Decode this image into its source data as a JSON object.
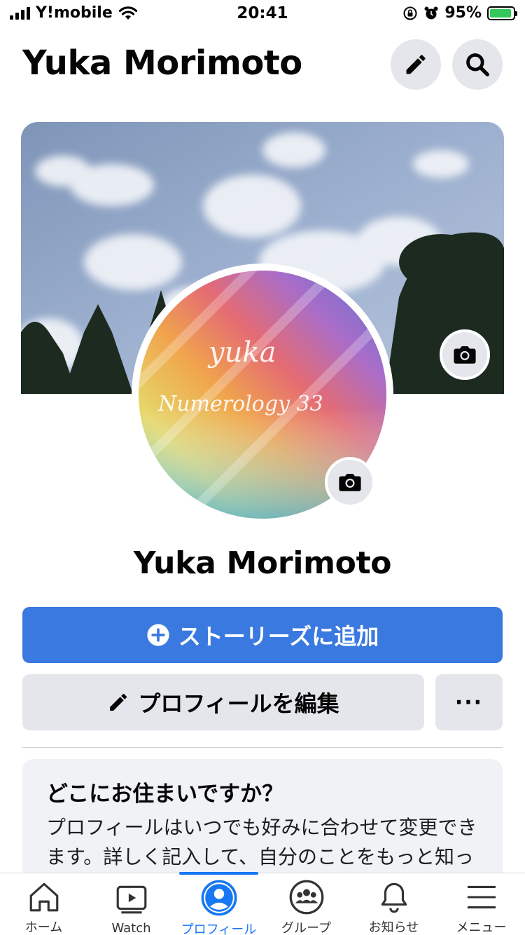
{
  "status_bar": {
    "carrier": "Y!mobile",
    "time": "20:41",
    "battery_percent": "95%",
    "battery_level": 0.95
  },
  "header": {
    "title": "Yuka Morimoto",
    "edit_icon": "pencil-icon",
    "search_icon": "search-icon"
  },
  "profile": {
    "name": "Yuka Morimoto",
    "avatar_text_line1": "yuka",
    "avatar_text_line2": "Numerology 33"
  },
  "actions": {
    "add_story_label": "ストーリーズに追加",
    "edit_profile_label": "プロフィールを編集",
    "more_label": "···"
  },
  "info_card": {
    "title": "どこにお住まいですか？",
    "body": "プロフィールはいつでも好みに合わせて変更できます。詳しく記入して、自分のことをもっと知ってもらおう。"
  },
  "tabs": [
    {
      "label": "ホーム",
      "icon": "home-icon"
    },
    {
      "label": "Watch",
      "icon": "watch-icon"
    },
    {
      "label": "プロフィール",
      "icon": "profile-icon",
      "active": true
    },
    {
      "label": "グループ",
      "icon": "groups-icon"
    },
    {
      "label": "お知らせ",
      "icon": "bell-icon"
    },
    {
      "label": "メニュー",
      "icon": "menu-icon"
    }
  ],
  "colors": {
    "primary_blue": "#3a79e0",
    "active_tab": "#1877f2",
    "button_gray": "#e4e6eb",
    "card_bg": "#f0f2f5"
  }
}
